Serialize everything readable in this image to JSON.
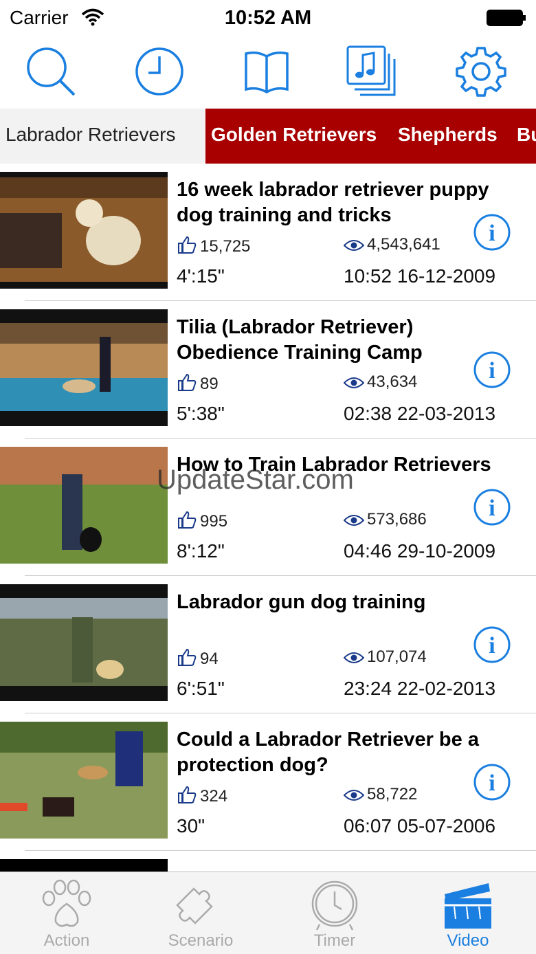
{
  "status_bar": {
    "carrier": "Carrier",
    "time": "10:52 AM"
  },
  "toolbar": {
    "icons": [
      "search-icon",
      "clock-icon",
      "book-icon",
      "music-playlist-icon",
      "gear-icon"
    ]
  },
  "category_tabs": [
    {
      "label": "Labrador Retrievers",
      "active": true
    },
    {
      "label": "Golden Retrievers",
      "active": false
    },
    {
      "label": "Shepherds",
      "active": false
    },
    {
      "label": "Bu",
      "active": false
    }
  ],
  "videos": [
    {
      "title": "16 week labrador retriever puppy dog training and tricks",
      "likes": "15,725",
      "views": "4,543,641",
      "duration": "4':15\"",
      "date": "10:52 16-12-2009"
    },
    {
      "title": "Tilia (Labrador Retriever) Obedience Training Camp",
      "likes": "89",
      "views": "43,634",
      "duration": "5':38\"",
      "date": "02:38 22-03-2013"
    },
    {
      "title": "How to Train Labrador Retrievers",
      "likes": "995",
      "views": "573,686",
      "duration": "8':12\"",
      "date": "04:46 29-10-2009"
    },
    {
      "title": "Labrador gun dog training",
      "likes": "94",
      "views": "107,074",
      "duration": "6':51\"",
      "date": "23:24 22-02-2013"
    },
    {
      "title": "Could a Labrador Retriever be a protection dog?",
      "likes": "324",
      "views": "58,722",
      "duration": "30\"",
      "date": "06:07 05-07-2006"
    }
  ],
  "watermark": "UpdateStar.com",
  "tab_bar": [
    {
      "label": "Action",
      "icon": "paw-icon",
      "active": false
    },
    {
      "label": "Scenario",
      "icon": "puzzle-icon",
      "active": false
    },
    {
      "label": "Timer",
      "icon": "stopwatch-icon",
      "active": false
    },
    {
      "label": "Video",
      "icon": "clapperboard-icon",
      "active": true
    }
  ],
  "colors": {
    "accent": "#1a7fe0",
    "tab_red": "#a80000"
  }
}
